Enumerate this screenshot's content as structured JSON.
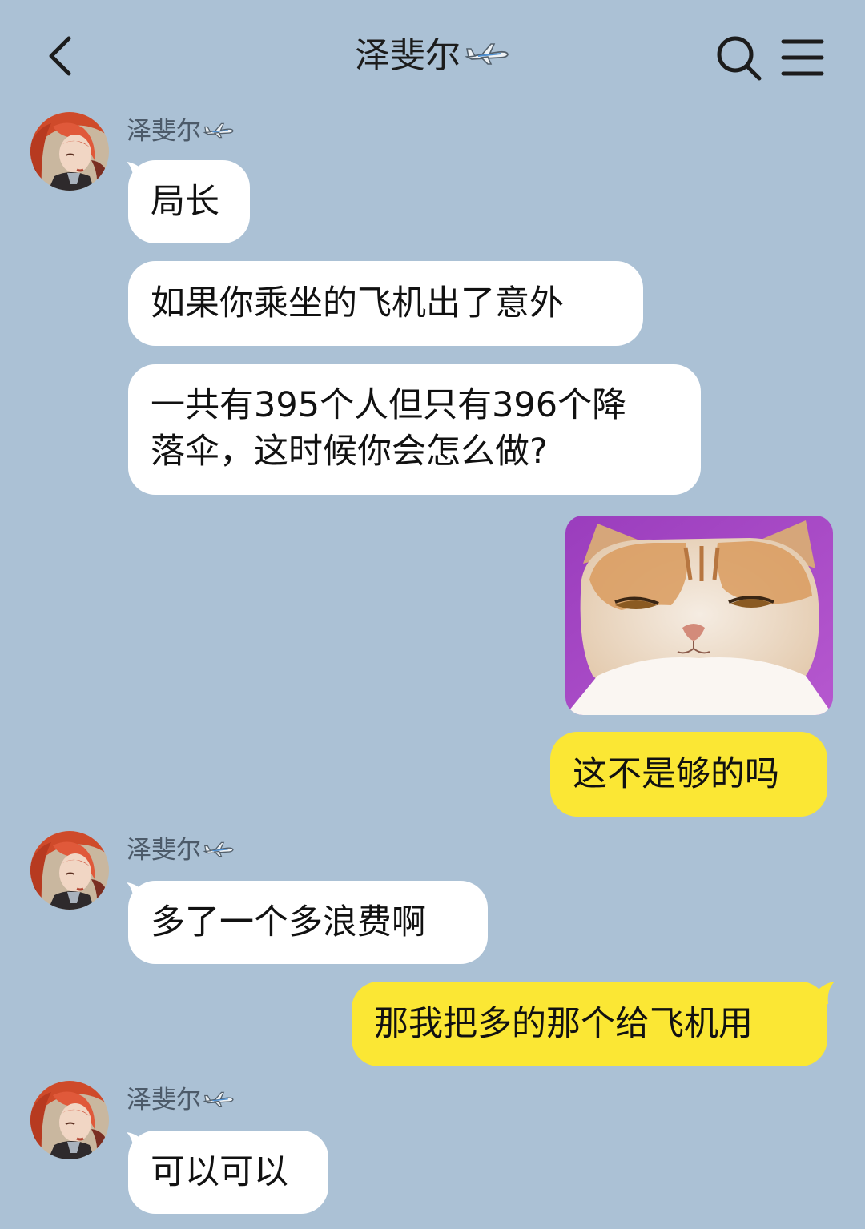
{
  "header": {
    "title": "泽斐尔",
    "back_icon": "chevron-left-icon",
    "search_icon": "search-icon",
    "menu_icon": "menu-icon",
    "title_badge_icon": "airplane-icon"
  },
  "colors": {
    "background": "#abc1d5",
    "incoming_bubble": "#ffffff",
    "outgoing_bubble": "#fbe734",
    "sender_name": "#4c5a69"
  },
  "messages": [
    {
      "sender": "泽斐尔",
      "direction": "incoming",
      "text": "局长"
    },
    {
      "sender": "泽斐尔",
      "direction": "incoming",
      "text": "如果你乘坐的飞机出了意外"
    },
    {
      "sender": "泽斐尔",
      "direction": "incoming",
      "lines": [
        "一共有395个人但只有396个降",
        "落伞，这时候你会怎么做?"
      ]
    },
    {
      "direction": "outgoing",
      "type": "sticker",
      "description_icon": "cat-face-sticker"
    },
    {
      "direction": "outgoing",
      "text": "这不是够的吗"
    },
    {
      "sender": "泽斐尔",
      "direction": "incoming",
      "text": "多了一个多浪费啊"
    },
    {
      "direction": "outgoing",
      "text": "那我把多的那个给飞机用"
    },
    {
      "sender": "泽斐尔",
      "direction": "incoming",
      "text": "可以可以"
    }
  ]
}
